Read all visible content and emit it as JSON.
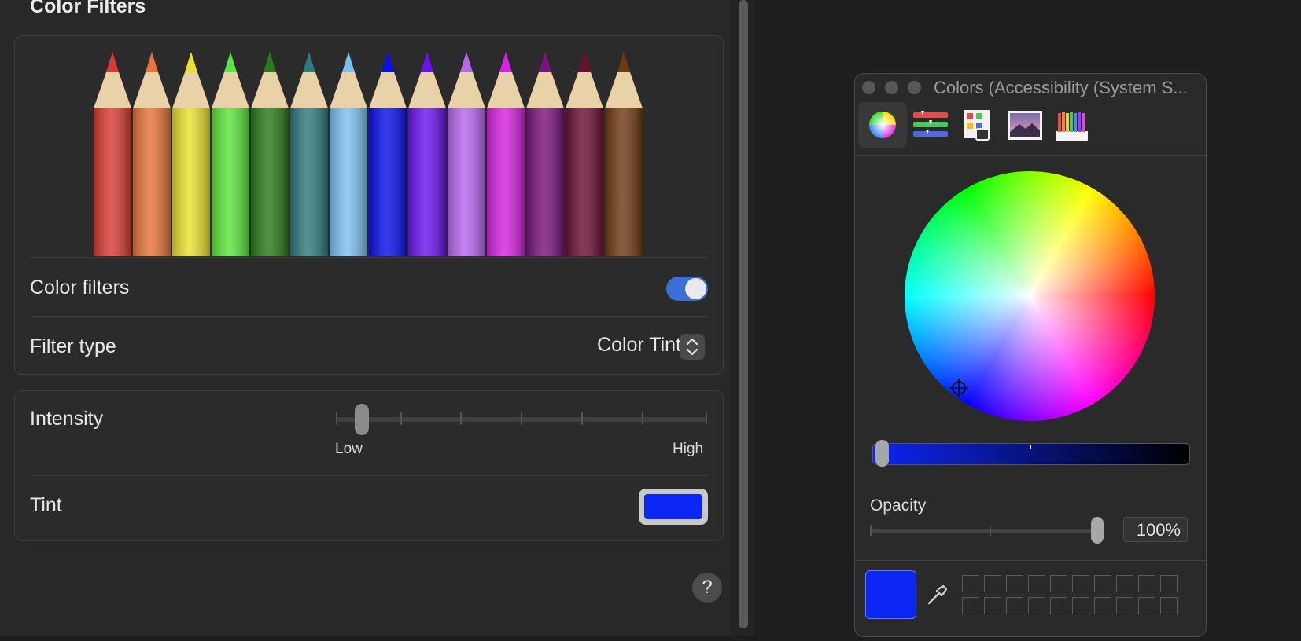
{
  "settings": {
    "section_title": "Color Filters",
    "pencil_colors": [
      "#d83b33",
      "#e8743a",
      "#e8e22f",
      "#5ce53d",
      "#2a7a1a",
      "#2f7a7c",
      "#7cc0f0",
      "#0a10e8",
      "#6a14ef",
      "#b568ef",
      "#d622e2",
      "#7a137d",
      "#6a0e34",
      "#6e3a12"
    ],
    "color_filters_label": "Color filters",
    "color_filters_enabled": true,
    "filter_type_label": "Filter type",
    "filter_type_value": "Color Tint",
    "intensity_label": "Intensity",
    "intensity_low": "Low",
    "intensity_high": "High",
    "intensity_value": 0.07,
    "tint_label": "Tint",
    "tint_color": "#0c26f4",
    "help_label": "?"
  },
  "colors_panel": {
    "title": "Colors (Accessibility (System S...",
    "toolbar": [
      "color-wheel-icon",
      "sliders-icon",
      "palettes-icon",
      "image-palette-icon",
      "pencils-icon"
    ],
    "selected_tool": "color-wheel-icon",
    "opacity_label": "Opacity",
    "opacity_value": "100%",
    "current_color": "#0c26f4"
  }
}
